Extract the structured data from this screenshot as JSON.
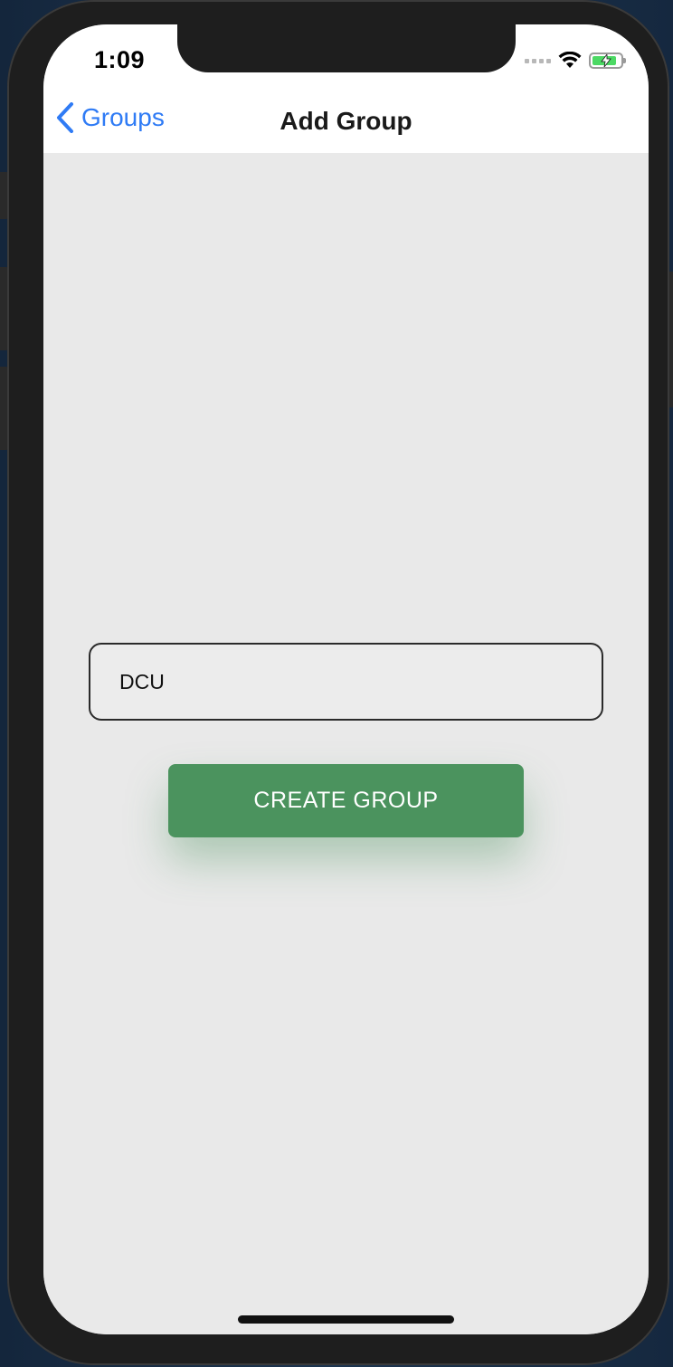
{
  "status_bar": {
    "time": "1:09",
    "icons": [
      "cellular-signal-icon",
      "wifi-icon",
      "battery-charging-icon"
    ]
  },
  "nav": {
    "back_label": "Groups",
    "title": "Add Group"
  },
  "form": {
    "group_name_value": "DCU",
    "create_button_label": "CREATE GROUP"
  },
  "colors": {
    "accent": "#2f7bf5",
    "button": "#4b935e",
    "background": "#e9e9e9",
    "header": "#ffffff",
    "battery_fill": "#4cd964"
  }
}
